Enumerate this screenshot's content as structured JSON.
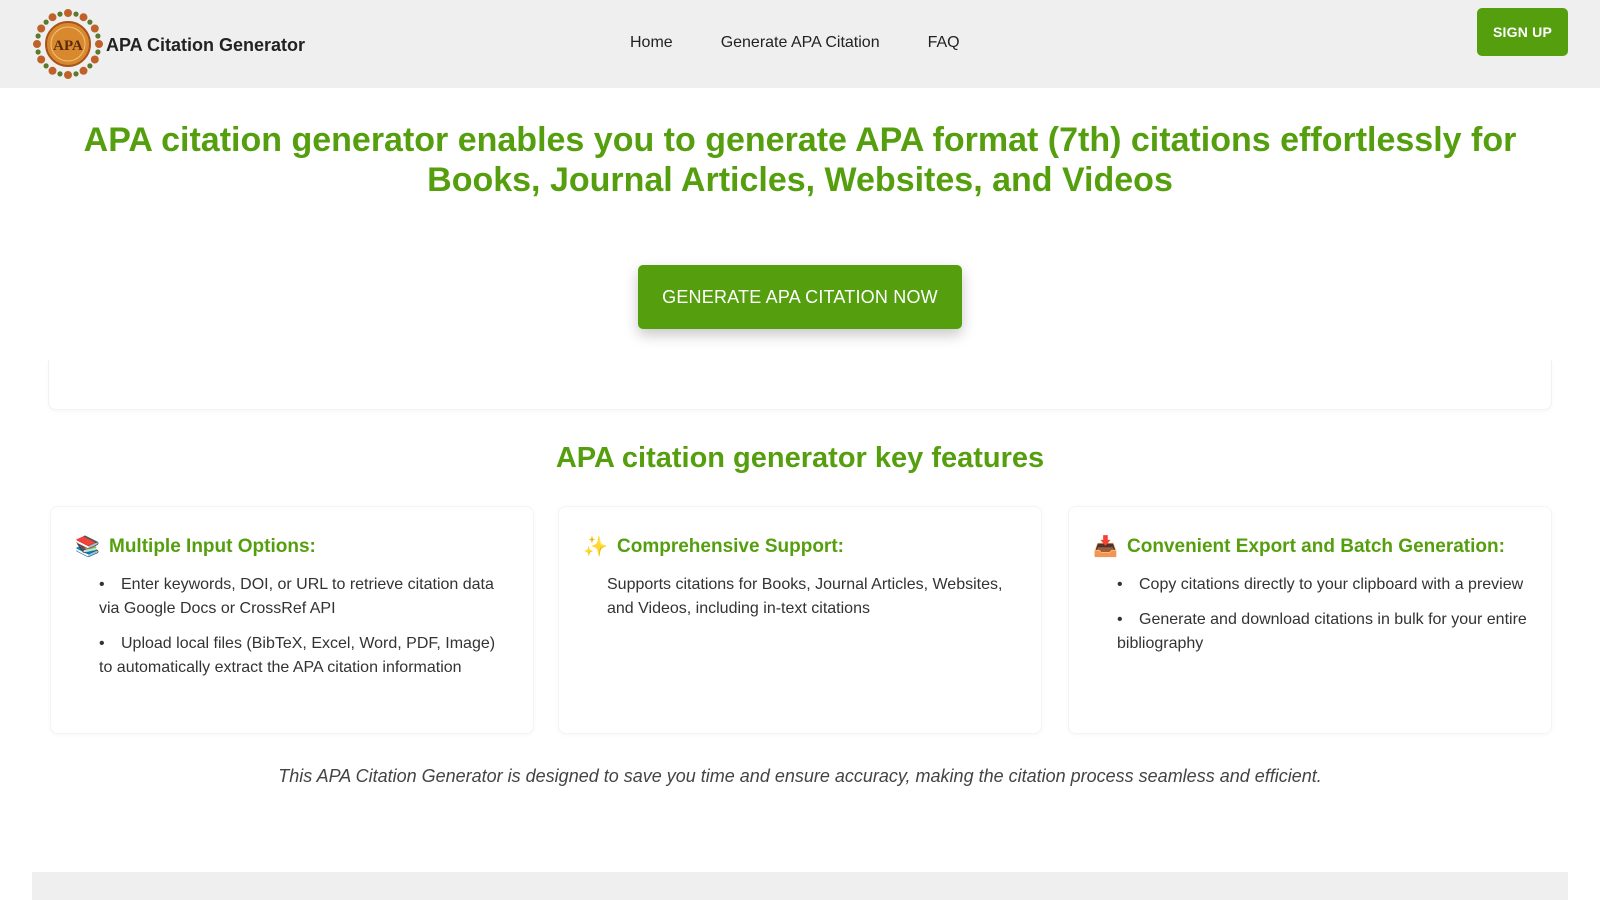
{
  "header": {
    "logo_text": "APA",
    "brand_name": "APA Citation Generator",
    "nav": [
      "Home",
      "Generate APA Citation",
      "FAQ"
    ],
    "signup_label": "SIGN UP"
  },
  "hero": {
    "title": "APA citation generator enables you to generate APA format (7th) citations effortlessly for Books, Journal Articles, Websites, and Videos",
    "cta_label": "GENERATE APA CITATION NOW"
  },
  "features": {
    "title": "APA citation generator key features",
    "cards": [
      {
        "icon": "📚",
        "icon_name": "books-icon",
        "title": "Multiple Input Options:",
        "items": [
          "Enter keywords, DOI, or URL to retrieve citation data via Google Docs or CrossRef API",
          "Upload local files (BibTeX, Excel, Word, PDF, Image) to automatically extract the APA citation information"
        ]
      },
      {
        "icon": "✨",
        "icon_name": "sparkles-icon",
        "title": "Comprehensive Support:",
        "text": "Supports citations for Books, Journal Articles, Websites, and Videos, including in-text citations"
      },
      {
        "icon": "📥",
        "icon_name": "inbox-tray-icon",
        "title": "Convenient Export and Batch Generation:",
        "items": [
          "Copy citations directly to your clipboard with a preview",
          "Generate and download citations in bulk for your entire bibliography"
        ]
      }
    ]
  },
  "tagline": "This APA Citation Generator is designed to save you time and ensure accuracy, making the citation process seamless and efficient.",
  "colors": {
    "accent": "#559f0f",
    "header_bg": "#efefef",
    "text": "#333333"
  }
}
